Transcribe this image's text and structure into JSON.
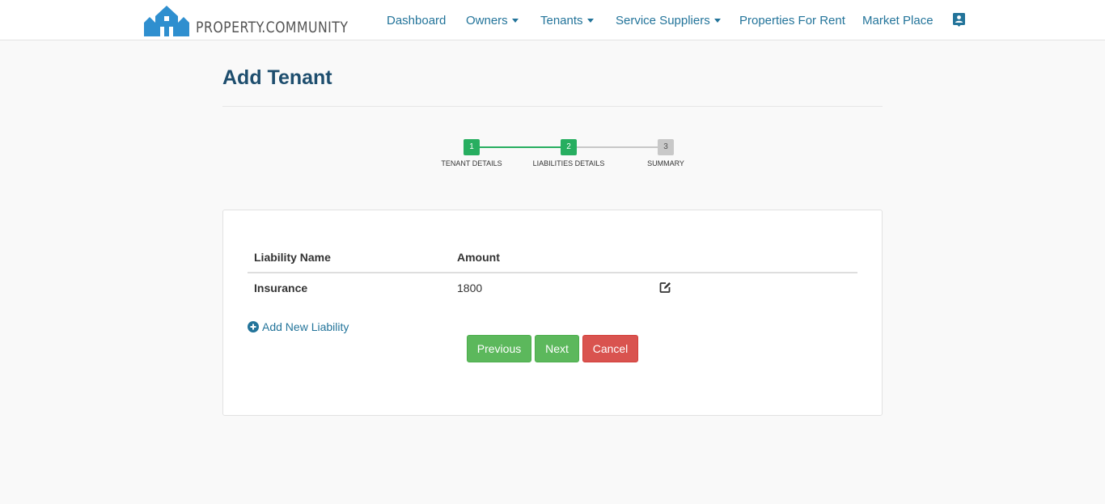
{
  "brand": {
    "name": "PROPERTY.COMMUNITY",
    "logo_icon": "house-logo-icon"
  },
  "nav": {
    "items": [
      {
        "label": "Dashboard",
        "dropdown": false
      },
      {
        "label": "Owners",
        "dropdown": true
      },
      {
        "label": "Tenants",
        "dropdown": true
      },
      {
        "label": "Service Suppliers",
        "dropdown": true
      },
      {
        "label": "Properties For Rent",
        "dropdown": false
      },
      {
        "label": "Market Place",
        "dropdown": false
      }
    ],
    "user_icon": "user-card-icon"
  },
  "page": {
    "title": "Add Tenant"
  },
  "stepper": {
    "steps": [
      {
        "number": "1",
        "label": "TENANT DETAILS",
        "state": "complete"
      },
      {
        "number": "2",
        "label": "LIABILITIES DETAILS",
        "state": "active"
      },
      {
        "number": "3",
        "label": "SUMMARY",
        "state": "pending"
      }
    ]
  },
  "table": {
    "headers": [
      "Liability Name",
      "Amount"
    ],
    "rows": [
      {
        "name": "Insurance",
        "amount": "1800",
        "action_icon": "edit-icon"
      }
    ]
  },
  "add_link": {
    "label": "Add New Liability",
    "icon": "plus-circle-icon"
  },
  "buttons": {
    "previous": "Previous",
    "next": "Next",
    "cancel": "Cancel"
  },
  "colors": {
    "link": "#23749a",
    "title": "#1e4e6e",
    "step_complete": "#27ae60",
    "step_pending": "#c8c8c8",
    "button_success": "#5cb85c",
    "button_danger": "#d9534f"
  }
}
